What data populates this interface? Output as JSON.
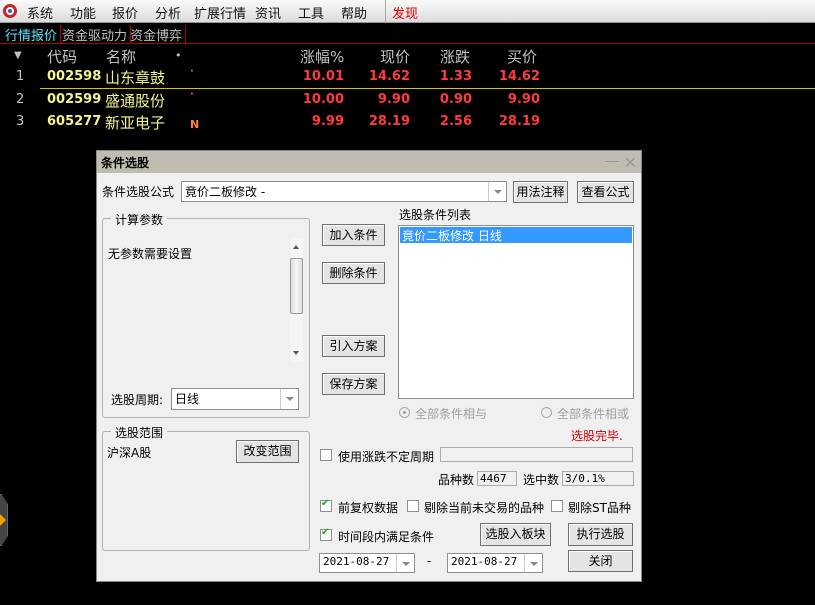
{
  "menubar": {
    "items": [
      "系统",
      "功能",
      "报价",
      "分析",
      "扩展行情",
      "资讯",
      "工具",
      "帮助"
    ],
    "discover": "发现"
  },
  "tabs": [
    "行情报价",
    "资金驱动力",
    "资金博弈"
  ],
  "quote_table": {
    "headers": {
      "code": "代码",
      "name": "名称",
      "dot": "•",
      "pct": "涨幅%",
      "price": "现价",
      "change": "涨跌",
      "bid": "买价"
    },
    "rows": [
      {
        "idx": "1",
        "code": "002598",
        "name": "山东章鼓",
        "flag": "·",
        "pct": "10.01",
        "price": "14.62",
        "change": "1.33",
        "bid": "14.62"
      },
      {
        "idx": "2",
        "code": "002599",
        "name": "盛通股份",
        "flag": "·",
        "pct": "10.00",
        "price": "9.90",
        "change": "0.90",
        "bid": "9.90"
      },
      {
        "idx": "3",
        "code": "605277",
        "name": "新亚电子",
        "flag": "N",
        "pct": "9.99",
        "price": "28.19",
        "change": "2.56",
        "bid": "28.19"
      }
    ]
  },
  "dialog": {
    "title": "条件选股",
    "formula_label": "条件选股公式",
    "formula_value": "竟价二板修改 -",
    "usage_button": "用法注释",
    "view_button": "查看公式",
    "params_group": "计算参数",
    "params_text": "无参数需要设置",
    "period_label": "选股周期:",
    "period_value": "日线",
    "add_button": "加入条件",
    "delete_button": "删除条件",
    "import_button": "引入方案",
    "save_button": "保存方案",
    "list_label": "选股条件列表",
    "list_items": [
      "竟价二板修改   日线"
    ],
    "radio_and": "全部条件相与",
    "radio_or": "全部条件相或",
    "status": "选股完毕.",
    "scope_group": "选股范围",
    "scope_value": "沪深A股",
    "change_scope_button": "改变范围",
    "use_period_label": "使用涨跌不定周期",
    "total_label": "品种数",
    "total_value": "4467",
    "selected_label": "选中数",
    "selected_value": "3/0.1%",
    "fq_label": "前复权数据",
    "exclude_untraded_label": "剔除当前未交易的品种",
    "exclude_st_label": "剔除ST品种",
    "timerange_label": "时间段内满足条件",
    "to_block_button": "选股入板块",
    "execute_button": "执行选股",
    "close_button": "关闭",
    "date_from": "2021-08-27",
    "date_sep": "-",
    "date_to": "2021-08-27"
  }
}
